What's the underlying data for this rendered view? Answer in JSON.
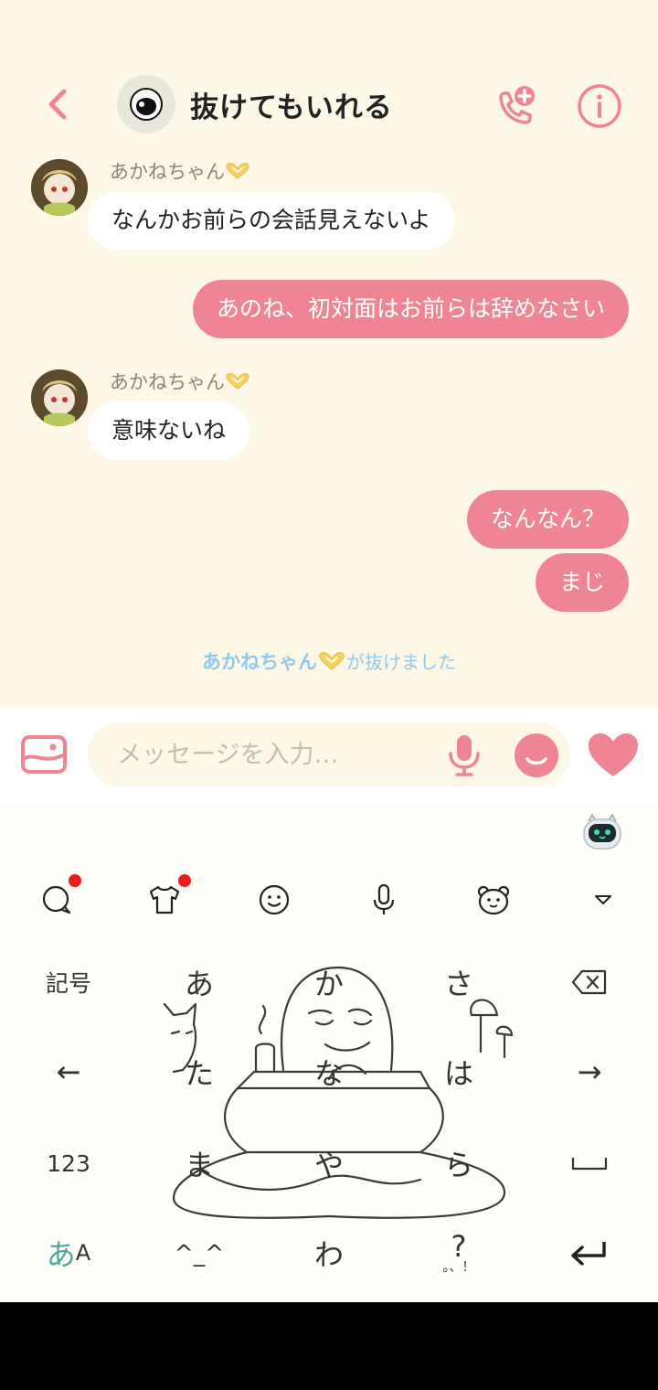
{
  "header": {
    "title": "抜けてもいれる"
  },
  "messages": [
    {
      "sender": "あかねちゃん",
      "text": "なんかお前らの会話見えないよ"
    },
    {
      "text": "あのね、初対面はお前らは辞めなさい"
    },
    {
      "sender": "あかねちゃん",
      "text": "意味ないね"
    },
    {
      "text": "なんなん？"
    },
    {
      "text": "まじ"
    }
  ],
  "system": {
    "name": "あかねちゃん",
    "suffix": "が抜けました"
  },
  "input": {
    "placeholder": "メッセージを入力…"
  },
  "keyboard": {
    "rows": [
      [
        "記号",
        "あ",
        "か",
        "さ",
        "⌫"
      ],
      [
        "←",
        "た",
        "な",
        "は",
        "→"
      ],
      [
        "123",
        "ま",
        "や",
        "ら",
        "␣"
      ],
      [
        "あA",
        "^_^",
        "わ",
        "?",
        "↵"
      ]
    ],
    "kana_switch_a": "あ",
    "kana_switch_latin": "A",
    "punct_sub": "。、！"
  },
  "colors": {
    "accent": "#ef8593",
    "chat_bg": "#fdf7e6",
    "system_text": "#8ec9ee"
  }
}
